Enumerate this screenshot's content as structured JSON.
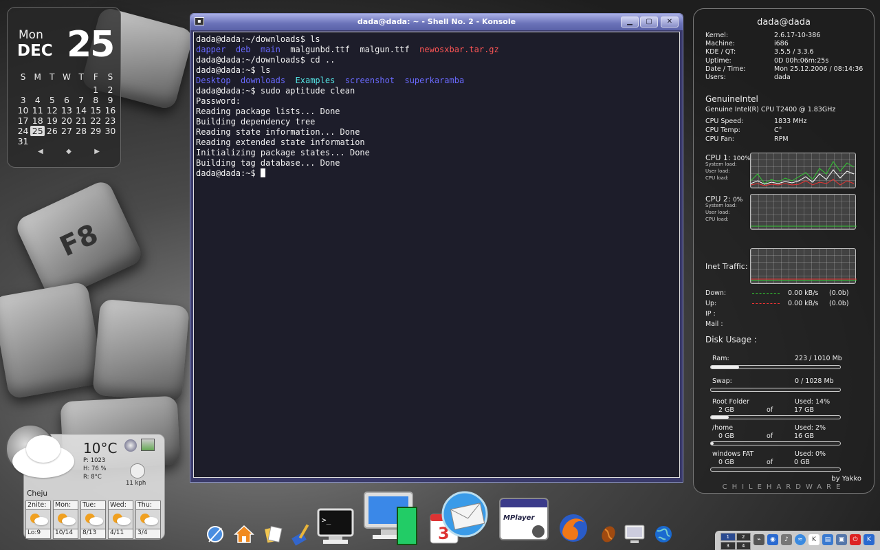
{
  "calendar": {
    "weekday": "Mon",
    "month": "DEC",
    "day": "25",
    "weekday_headers": [
      "S",
      "M",
      "T",
      "W",
      "T",
      "F",
      "S"
    ],
    "weeks": [
      [
        "",
        "",
        "",
        "",
        "",
        "1",
        "2"
      ],
      [
        "3",
        "4",
        "5",
        "6",
        "7",
        "8",
        "9"
      ],
      [
        "10",
        "11",
        "12",
        "13",
        "14",
        "15",
        "16"
      ],
      [
        "17",
        "18",
        "19",
        "20",
        "21",
        "22",
        "23"
      ],
      [
        "24",
        "25",
        "26",
        "27",
        "28",
        "29",
        "30"
      ],
      [
        "31",
        "",
        "",
        "",
        "",
        "",
        ""
      ]
    ],
    "today": "25"
  },
  "konsole": {
    "title": "dada@dada: ~ - Shell No. 2 - Konsole",
    "lines": [
      [
        {
          "t": "dada@dada:~/downloads$ ls"
        }
      ],
      [
        {
          "t": "dapper",
          "c": "c-blue"
        },
        {
          "t": "  "
        },
        {
          "t": "deb",
          "c": "c-blue"
        },
        {
          "t": "  "
        },
        {
          "t": "main",
          "c": "c-blue"
        },
        {
          "t": "  malgunbd.ttf  malgun.ttf  "
        },
        {
          "t": "newosxbar.tar.gz",
          "c": "c-red"
        }
      ],
      [
        {
          "t": "dada@dada:~/downloads$ cd .."
        }
      ],
      [
        {
          "t": "dada@dada:~$ ls"
        }
      ],
      [
        {
          "t": "Desktop",
          "c": "c-blue"
        },
        {
          "t": "  "
        },
        {
          "t": "downloads",
          "c": "c-blue"
        },
        {
          "t": "  "
        },
        {
          "t": "Examples",
          "c": "c-cyan"
        },
        {
          "t": "  "
        },
        {
          "t": "screenshot",
          "c": "c-blue"
        },
        {
          "t": "  "
        },
        {
          "t": "superkaramba",
          "c": "c-blue"
        }
      ],
      [
        {
          "t": "dada@dada:~$ sudo aptitude clean"
        }
      ],
      [
        {
          "t": "Password:"
        }
      ],
      [
        {
          "t": "Reading package lists... Done"
        }
      ],
      [
        {
          "t": "Building dependency tree"
        }
      ],
      [
        {
          "t": "Reading state information... Done"
        }
      ],
      [
        {
          "t": "Reading extended state information"
        }
      ],
      [
        {
          "t": "Initializing package states... Done"
        }
      ],
      [
        {
          "t": "Building tag database... Done"
        }
      ],
      [
        {
          "t": "dada@dada:~$ "
        }
      ]
    ]
  },
  "sysmon": {
    "user_host": "dada@dada",
    "system": [
      {
        "k": "Kernel:",
        "v": "2.6.17-10-386"
      },
      {
        "k": "Machine:",
        "v": "i686"
      },
      {
        "k": "KDE / QT:",
        "v": "3.5.5                / 3.3.6"
      },
      {
        "k": "Uptime:",
        "v": "0D    00h:06m:25s"
      },
      {
        "k": "Date / Time:",
        "v": "Mon 25.12.2006  /  08:14:36"
      },
      {
        "k": "Users:",
        "v": "dada"
      }
    ],
    "cpu_vendor": "GenuineIntel",
    "cpu_model": "Genuine Intel(R) CPU        T2400  @ 1.83GHz",
    "cpu_info": [
      {
        "k": "CPU Speed:",
        "v": "1833 MHz"
      },
      {
        "k": "CPU Temp:",
        "v": "  C°"
      },
      {
        "k": "CPU Fan:",
        "v": "  RPM"
      }
    ],
    "cpu1_label": "CPU 1:",
    "cpu1_value": "100%",
    "cpu2_label": "CPU 2:",
    "cpu2_value": "0%",
    "load_labels": [
      "System load:",
      "User load:",
      "CPU load:"
    ],
    "inet_label": "Inet Traffic:",
    "down_label": "Down:",
    "down_value": "0.00 kB/s",
    "down_total": "(0.0b)",
    "up_label": "Up:",
    "up_value": "0.00 kB/s",
    "up_total": "(0.0b)",
    "ip_label": "IP :",
    "mail_label": "Mail :",
    "disk_label": "Disk Usage :",
    "ram_label": "Ram:",
    "ram_value": "223 / 1010 Mb",
    "ram_fraction": 0.22,
    "swap_label": "Swap:",
    "swap_value": "0 / 1028 Mb",
    "swap_fraction": 0.0,
    "disks": [
      {
        "name": "Root Folder",
        "used": "Used: 14%",
        "left": "2 GB",
        "of": "of",
        "total": "17 GB",
        "fraction": 0.14
      },
      {
        "name": "/home",
        "used": "Used: 2%",
        "left": "0 GB",
        "of": "of",
        "total": "16 GB",
        "fraction": 0.02
      },
      {
        "name": "windows FAT",
        "used": "Used: 0%",
        "left": "0 GB",
        "of": "of",
        "total": "0 GB",
        "fraction": 0.0
      }
    ],
    "credit": "by Yakko",
    "watermark": "CHILEHARDWARE"
  },
  "weather": {
    "temp": "10°C",
    "pressure": "P:   1023",
    "humidity": "H:   76 %",
    "realfeel": "R:   8°C",
    "wind": "11 kph",
    "city": "Cheju",
    "forecast": [
      {
        "day": "2nite:",
        "lo": "Lo:9"
      },
      {
        "day": "Mon:",
        "lo": "10/14"
      },
      {
        "day": "Tue:",
        "lo": "8/13"
      },
      {
        "day": "Wed:",
        "lo": "4/11"
      },
      {
        "day": "Thu:",
        "lo": "3/4"
      }
    ]
  },
  "dock": {
    "apps": [
      "finder-icon",
      "home-icon",
      "files-icon",
      "cleaner-icon",
      "terminal-icon",
      "system-monitor-icon",
      "ical-icon",
      "mail-icon",
      "mplayer-icon",
      "firefox-icon",
      "coffee-icon",
      "display-icon",
      "globe-icon"
    ],
    "mplayer_label": "MPlayer",
    "ical_day": "3"
  },
  "tray": {
    "pager": [
      "1",
      "2",
      "3",
      "4"
    ]
  }
}
